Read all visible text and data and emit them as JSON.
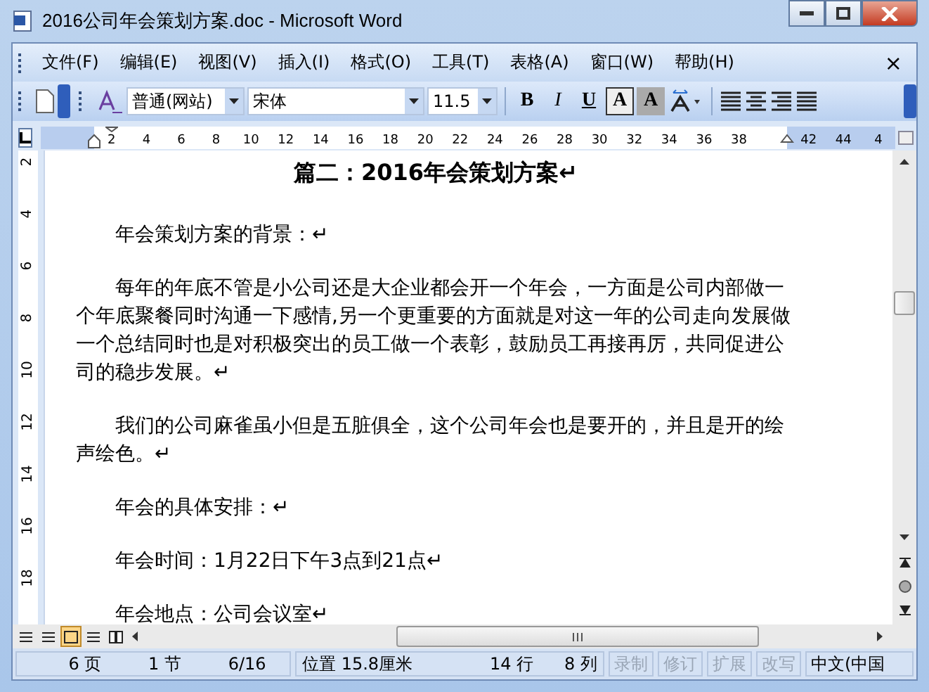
{
  "window": {
    "title": "2016公司年会策划方案.doc - Microsoft Word"
  },
  "menu": {
    "items": [
      "文件(F)",
      "编辑(E)",
      "视图(V)",
      "插入(I)",
      "格式(O)",
      "工具(T)",
      "表格(A)",
      "窗口(W)",
      "帮助(H)"
    ],
    "close": "×"
  },
  "toolbar": {
    "style": "普通(网站)",
    "font": "宋体",
    "size": "11.5",
    "format_buttons": [
      {
        "kind": "bold",
        "label": "B"
      },
      {
        "kind": "italic",
        "label": "I"
      },
      {
        "kind": "underline",
        "label": "U"
      },
      {
        "kind": "boxed",
        "label": "A"
      },
      {
        "kind": "shaded",
        "label": "A"
      }
    ]
  },
  "ruler": {
    "ticks": [
      "2",
      "4",
      "6",
      "8",
      "10",
      "12",
      "14",
      "16",
      "18",
      "20",
      "22",
      "24",
      "26",
      "28",
      "30",
      "32",
      "34",
      "36",
      "38"
    ],
    "right_ticks": [
      "42",
      "44",
      "4"
    ],
    "vertical_ticks": [
      "2",
      "4",
      "6",
      "8",
      "10",
      "12",
      "14",
      "16",
      "18"
    ]
  },
  "document": {
    "title": "篇二：2016年会策划方案↵",
    "paragraphs": [
      "年会策划方案的背景：↵",
      "每年的年底不管是小公司还是大企业都会开一个年会，一方面是公司内部做一个年底聚餐同时沟通一下感情,另一个更重要的方面就是对这一年的公司走向发展做一个总结同时也是对积极突出的员工做一个表彰，鼓励员工再接再厉，共同促进公司的稳步发展。↵",
      "我们的公司麻雀虽小但是五脏俱全，这个公司年会也是要开的，并且是开的绘声绘色。↵",
      "年会的具体安排：↵",
      "年会时间：1月22日下午3点到21点↵",
      "年会地点：公司会议室↵"
    ]
  },
  "view_buttons": [
    {
      "selected": false
    },
    {
      "selected": false
    },
    {
      "selected": true
    },
    {
      "selected": false
    },
    {
      "selected": false
    }
  ],
  "status_bar": {
    "page": "6 页",
    "section": "1 节",
    "pages": "6/16",
    "position": "位置 15.8厘米",
    "line": "14 行",
    "column": "8 列",
    "modes": [
      {
        "label": "录制",
        "disabled": true
      },
      {
        "label": "修订",
        "disabled": true
      },
      {
        "label": "扩展",
        "disabled": true
      },
      {
        "label": "改写",
        "disabled": true
      }
    ],
    "language": "中文(中国"
  }
}
